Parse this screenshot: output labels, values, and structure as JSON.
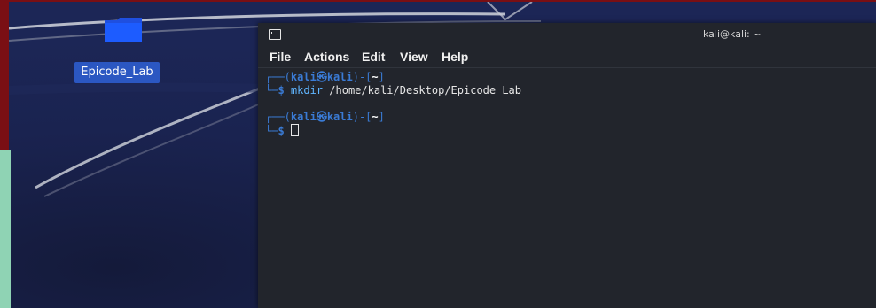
{
  "desktop": {
    "icon_label": "Epicode_Lab"
  },
  "terminal": {
    "title": "kali@kali: ~",
    "menu": [
      "File",
      "Actions",
      "Edit",
      "View",
      "Help"
    ],
    "prompt": {
      "open": "┌──(",
      "user": "kali",
      "at": "㉿",
      "host": "kali",
      "mid": ")-[",
      "dir": "~",
      "close": "]",
      "bottom": "└─",
      "dollar": "$"
    },
    "command": "mkdir",
    "argument": " /home/kali/Desktop/Epicode_Lab"
  }
}
